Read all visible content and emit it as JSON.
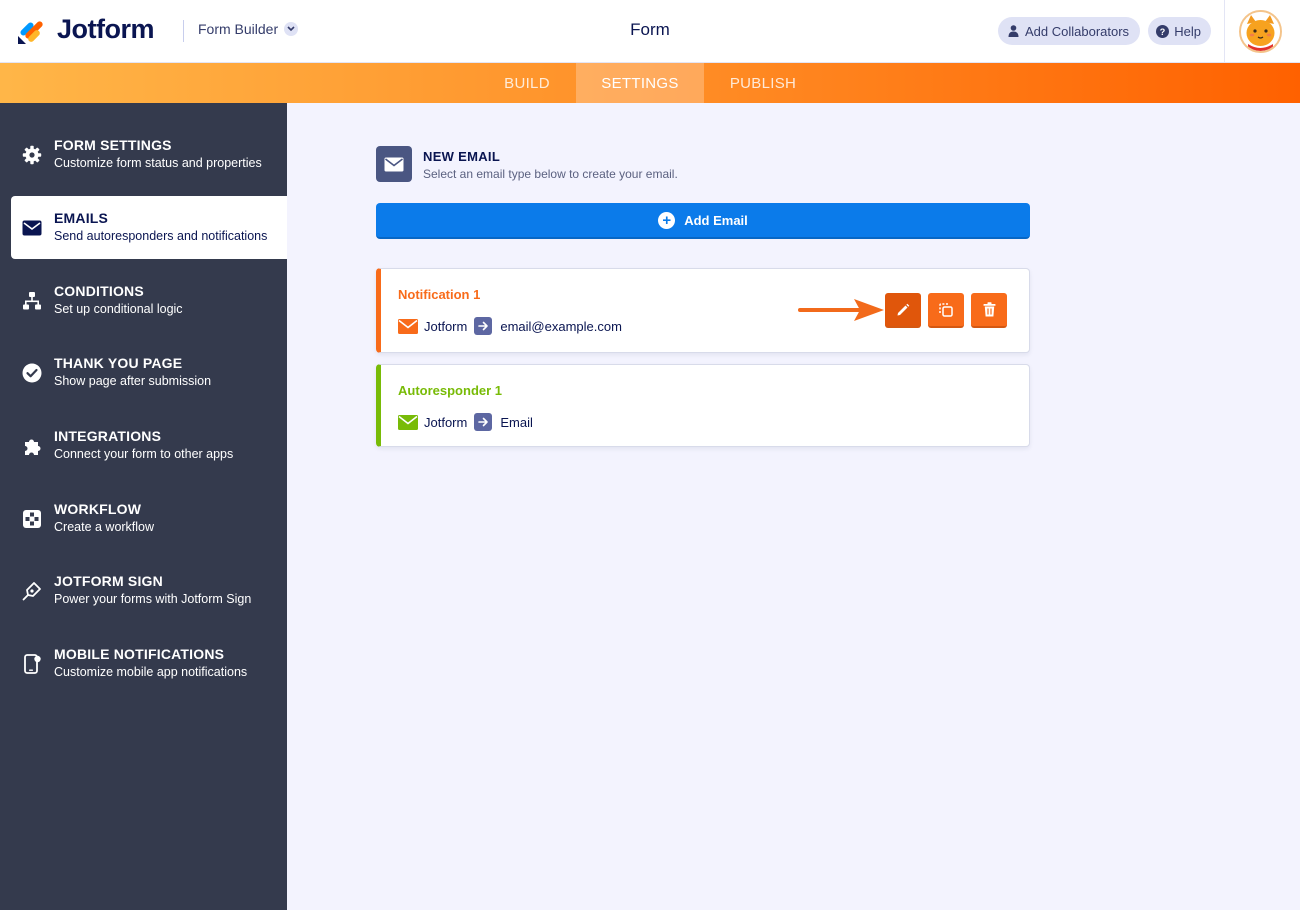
{
  "header": {
    "brand": "Jotform",
    "builder_menu": "Form Builder",
    "form_title": "Form",
    "add_collaborators": "Add Collaborators",
    "help": "Help"
  },
  "nav": {
    "tabs": [
      {
        "label": "BUILD"
      },
      {
        "label": "SETTINGS",
        "active": true
      },
      {
        "label": "PUBLISH"
      }
    ]
  },
  "sidebar": {
    "items": [
      {
        "title": "FORM SETTINGS",
        "subtitle": "Customize form status and properties",
        "icon": "gear-icon"
      },
      {
        "title": "EMAILS",
        "subtitle": "Send autoresponders and notifications",
        "icon": "envelope-icon",
        "active": true
      },
      {
        "title": "CONDITIONS",
        "subtitle": "Set up conditional logic",
        "icon": "sitemap-icon"
      },
      {
        "title": "THANK YOU PAGE",
        "subtitle": "Show page after submission",
        "icon": "check-circle-icon"
      },
      {
        "title": "INTEGRATIONS",
        "subtitle": "Connect your form to other apps",
        "icon": "puzzle-icon"
      },
      {
        "title": "WORKFLOW",
        "subtitle": "Create a workflow",
        "icon": "workflow-icon"
      },
      {
        "title": "JOTFORM SIGN",
        "subtitle": "Power your forms with Jotform Sign",
        "icon": "pen-nib-icon"
      },
      {
        "title": "MOBILE NOTIFICATIONS",
        "subtitle": "Customize mobile app notifications",
        "icon": "mobile-icon"
      }
    ]
  },
  "main": {
    "new_email_title": "NEW EMAIL",
    "new_email_subtitle": "Select an email type below to create your email.",
    "add_email_label": "Add Email",
    "emails": [
      {
        "name": "Notification 1",
        "from": "Jotform",
        "to": "email@example.com",
        "type": "notification",
        "color": "#f86b1a"
      },
      {
        "name": "Autoresponder 1",
        "from": "Jotform",
        "to": "Email",
        "type": "autoresponder",
        "color": "#78bb07"
      }
    ]
  },
  "colors": {
    "accent_orange": "#ff6100",
    "sidebar_bg": "#343a4d",
    "primary_blue": "#0b7bea",
    "notification": "#f86b1a",
    "autoresponder": "#78bb07"
  }
}
